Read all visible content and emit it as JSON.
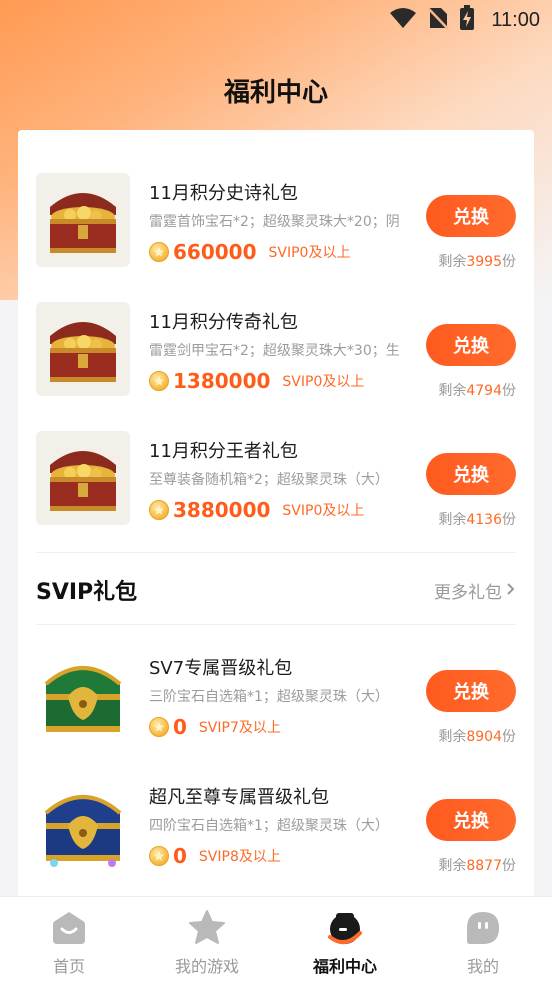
{
  "status": {
    "time": "11:00"
  },
  "header": {
    "title": "福利中心"
  },
  "points_gifts": [
    {
      "name": "11月积分史诗礼包",
      "desc": "雷霆首饰宝石*2；超级聚灵珠大*20；阴",
      "price": "660000",
      "vip": "SVIP0及以上",
      "button": "兑换",
      "stock_prefix": "剩余",
      "stock": "3995",
      "stock_suffix": "份"
    },
    {
      "name": "11月积分传奇礼包",
      "desc": "雷霆剑甲宝石*2；超级聚灵珠大*30；生",
      "price": "1380000",
      "vip": "SVIP0及以上",
      "button": "兑换",
      "stock_prefix": "剩余",
      "stock": "4794",
      "stock_suffix": "份"
    },
    {
      "name": "11月积分王者礼包",
      "desc": "至尊装备随机箱*2；超级聚灵珠（大）",
      "price": "3880000",
      "vip": "SVIP0及以上",
      "button": "兑换",
      "stock_prefix": "剩余",
      "stock": "4136",
      "stock_suffix": "份"
    }
  ],
  "svip_section": {
    "title": "SVIP礼包",
    "more": "更多礼包"
  },
  "svip_gifts": [
    {
      "name": "SV7专属晋级礼包",
      "desc": "三阶宝石自选箱*1；超级聚灵珠（大）",
      "price": "0",
      "vip": "SVIP7及以上",
      "button": "兑换",
      "stock_prefix": "剩余",
      "stock": "8904",
      "stock_suffix": "份"
    },
    {
      "name": "超凡至尊专属晋级礼包",
      "desc": "四阶宝石自选箱*1；超级聚灵珠（大）",
      "price": "0",
      "vip": "SVIP8及以上",
      "button": "兑换",
      "stock_prefix": "剩余",
      "stock": "8877",
      "stock_suffix": "份"
    }
  ],
  "tabs": [
    {
      "label": "首页",
      "icon": "home-icon",
      "active": false
    },
    {
      "label": "我的游戏",
      "icon": "star-icon",
      "active": false
    },
    {
      "label": "福利中心",
      "icon": "welfare-icon",
      "active": true
    },
    {
      "label": "我的",
      "icon": "profile-icon",
      "active": false
    }
  ],
  "colors": {
    "accent": "#ff5c1a",
    "button": "#ff5a1f",
    "header_gradient": "#ff9a52"
  }
}
